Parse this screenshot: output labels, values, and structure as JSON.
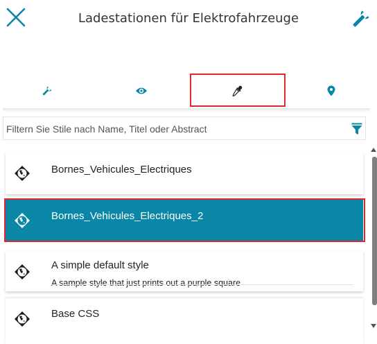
{
  "header": {
    "title": "Ladestationen für Elektrofahrzeuge",
    "close_icon": "close-icon",
    "settings_icon": "wrench-icon"
  },
  "tabs": [
    {
      "icon": "wrench-icon",
      "selected": false
    },
    {
      "icon": "eye-icon",
      "selected": false
    },
    {
      "icon": "eyedropper-icon",
      "selected": true
    },
    {
      "icon": "map-pin-icon",
      "selected": false
    }
  ],
  "filter": {
    "placeholder": "Filtern Sie Stile nach Name, Titel oder Abstract",
    "icon": "funnel-icon"
  },
  "styles": [
    {
      "title": "Bornes_Vehicules_Electriques",
      "subtitle": "",
      "icon": "globe-icon",
      "selected": false
    },
    {
      "title": "Bornes_Vehicules_Electriques_2",
      "subtitle": "",
      "icon": "globe-icon",
      "selected": true
    },
    {
      "title": "A simple default style",
      "subtitle": "A sample style that just prints out a purple square",
      "icon": "globe-icon",
      "selected": false
    },
    {
      "title": "Base CSS",
      "subtitle": "",
      "icon": "globe-icon",
      "selected": false
    }
  ],
  "colors": {
    "accent": "#0a86a6",
    "highlight": "#e0262b"
  }
}
